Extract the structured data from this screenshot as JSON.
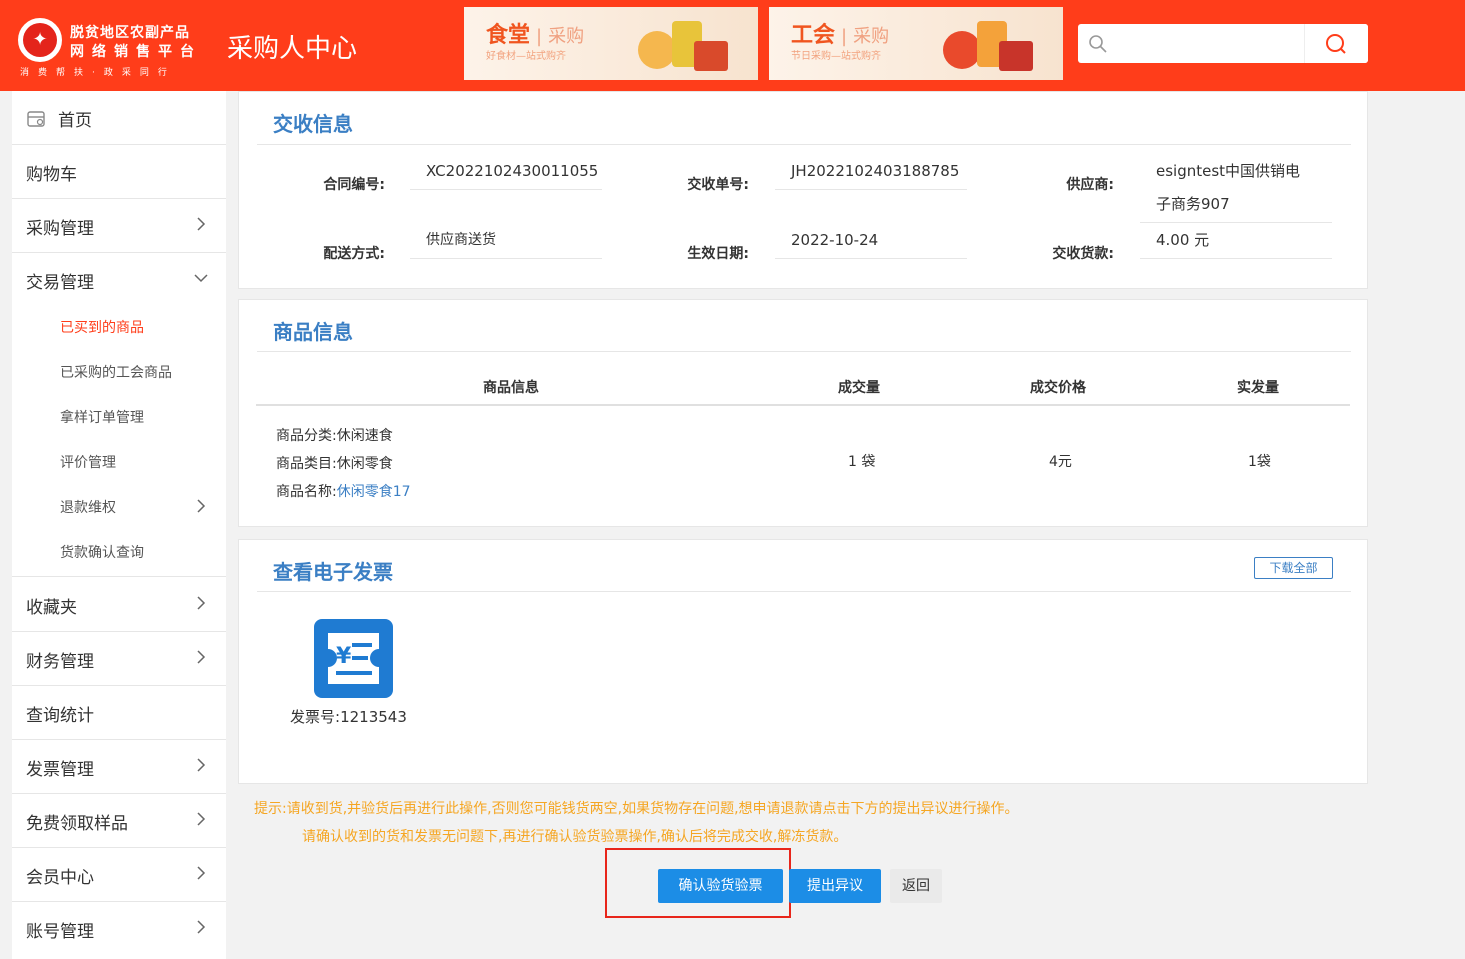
{
  "header": {
    "brand_line1": "脱贫地区农副产品",
    "brand_line2": "网络销售平台",
    "brand_line3": "消费帮扶·政采同行",
    "center_title": "采购人中心",
    "banners": [
      {
        "title": "食堂",
        "tag": "采购",
        "subtitle": "好食材—站式购齐"
      },
      {
        "title": "工会",
        "tag": "采购",
        "subtitle": "节日采购—站式购齐"
      }
    ],
    "search": {
      "placeholder": "",
      "value": ""
    }
  },
  "sidebar": {
    "items": [
      {
        "label": "首页",
        "icon": "home-icon"
      },
      {
        "label": "购物车"
      },
      {
        "label": "采购管理"
      },
      {
        "label": "交易管理"
      },
      {
        "label": "收藏夹"
      },
      {
        "label": "财务管理"
      },
      {
        "label": "查询统计"
      },
      {
        "label": "发票管理"
      },
      {
        "label": "免费领取样品"
      },
      {
        "label": "会员中心"
      },
      {
        "label": "账号管理"
      }
    ],
    "sub_items": [
      {
        "label": "已买到的商品",
        "active": true
      },
      {
        "label": "已采购的工会商品"
      },
      {
        "label": "拿样订单管理"
      },
      {
        "label": "评价管理"
      },
      {
        "label": "退款维权"
      },
      {
        "label": "货款确认查询"
      }
    ]
  },
  "receipt": {
    "title": "交收信息",
    "contract_no_label": "合同编号:",
    "contract_no": "XC2022102430011055",
    "receipt_no_label": "交收单号:",
    "receipt_no": "JH2022102403188785",
    "supplier_label": "供应商:",
    "supplier_line1": "esigntest中国供销电",
    "supplier_line2": "子商务907",
    "delivery_label": "配送方式:",
    "delivery": "供应商送货",
    "effective_date_label": "生效日期:",
    "effective_date": "2022-10-24",
    "payment_label": "交收货款:",
    "payment": "4.00 元"
  },
  "goods": {
    "title": "商品信息",
    "columns": [
      "商品信息",
      "成交量",
      "成交价格",
      "实发量"
    ],
    "row": {
      "category_label": "商品分类:",
      "category": "休闲速食",
      "class_label": "商品类目:",
      "class": "休闲零食",
      "name_label": "商品名称:",
      "name": "休闲零食17",
      "quantity": "1 袋",
      "price": "4元",
      "shipped": "1袋"
    }
  },
  "invoice": {
    "title": "查看电子发票",
    "download_all": "下载全部",
    "invoice_label": "发票号:",
    "invoice_no": "1213543"
  },
  "tips": {
    "prefix": "提示:",
    "line1": "请收到货,并验货后再进行此操作,否则您可能钱货两空,如果货物存在问题,想申请退款请点击下方的提出异议进行操作。",
    "line2": "请确认收到的货和发票无问题下,再进行确认验货验票操作,确认后将完成交收,解冻货款。"
  },
  "actions": {
    "confirm": "确认验货验票",
    "objection": "提出异议",
    "back": "返回"
  },
  "colors": {
    "header_bg": "#ff3d1a",
    "accent_blue": "#3b7fc4",
    "button_blue": "#1c8de6",
    "tip_orange": "#f5a623",
    "highlight_red": "#e8261b"
  }
}
